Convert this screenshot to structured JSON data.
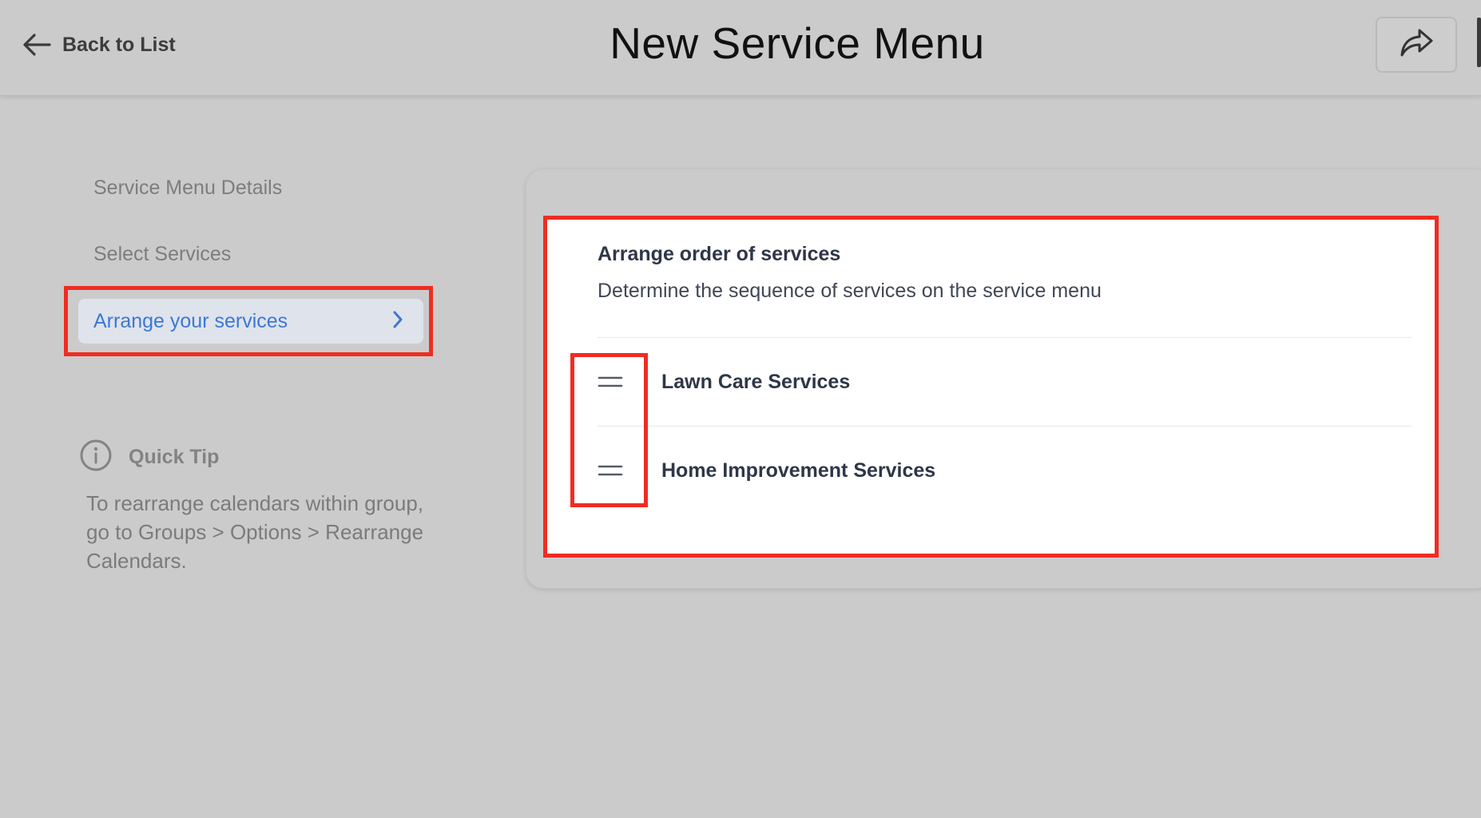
{
  "header": {
    "back_label": "Back to List",
    "back_icon": "arrow-left-icon",
    "title": "New Service Menu",
    "share_icon": "share-forward-icon"
  },
  "steps": {
    "items": [
      {
        "label": "Service Menu Details",
        "active": false
      },
      {
        "label": "Select Services",
        "active": false
      },
      {
        "label": "Arrange your services",
        "active": true,
        "icon": "chevron-right-icon"
      }
    ]
  },
  "tip": {
    "icon": "info-circle-icon",
    "title": "Quick Tip",
    "body": "To rearrange calendars within group, go to Groups > Options > Rearrange Calendars."
  },
  "arrange": {
    "title": "Arrange order of services",
    "description": "Determine the sequence of services on the service menu",
    "handle_icon": "drag-handle-icon",
    "services": [
      {
        "name": "Lawn Care Services"
      },
      {
        "name": "Home Improvement Services"
      }
    ]
  },
  "colors": {
    "page_bg": "#cbcbcb",
    "accent_blue": "#3b78d8",
    "active_step_bg": "#dfe3eb",
    "highlight_red": "#f02c22",
    "panel_bg": "#ffffff"
  }
}
